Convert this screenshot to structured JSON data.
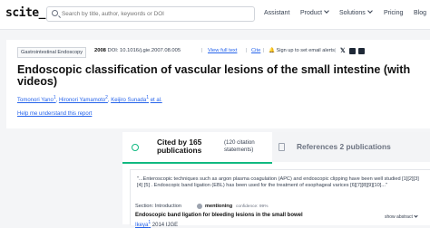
{
  "header": {
    "logo": "scite_",
    "search_placeholder": "Search by title, author, keywords or DOI",
    "nav": {
      "assistant": "Assistant",
      "product": "Product",
      "solutions": "Solutions",
      "pricing": "Pricing",
      "blog": "Blog"
    }
  },
  "paper": {
    "journal": "Gastrointestinal Endoscopy",
    "year": "2008",
    "doi": "DOI: 10.1016/j.gie.2007.08.005",
    "view_full_text": "View full text",
    "cite": "Cite",
    "email_alerts": "Sign up to set email alerts",
    "title": "Endoscopic classification of vascular lesions of the small intestine (with videos)",
    "authors": [
      {
        "name": "Tomonori Yano",
        "sup": "1"
      },
      {
        "name": "Hironori Yamamoto",
        "sup": "2"
      },
      {
        "name": "Keijiro Sunada",
        "sup": "1"
      }
    ],
    "et_al": "et al.",
    "help_link": "Help me understand this report"
  },
  "citations": {
    "cited_by_line1": "Cited by 165",
    "cited_by_line2": "publications",
    "statements_line1": "(120 citation",
    "statements_line2": "statements)",
    "references": "References 2 publications",
    "first_excerpt": "\"...Enteroscopic techniques such as argon plasma coagulation (APC) and endoscopic clipping have been well studied [1][2][3] [4] [5] . Endoscopic band ligation (EBL) has been used for the treatment of esophageal varices [6][7][8][9][10]...\"",
    "section": "Section: Introduction",
    "mention_label": "mentioning",
    "confidence": "confidence: 99%",
    "citing_title": "Endoscopic band ligation for bleeding lesions in the small bowel",
    "citing_author": "Ikeya",
    "citing_sup": "1",
    "citing_year": "2014",
    "citing_code": "IJGE",
    "show_abstract": "show abstract"
  },
  "colors": {
    "accent": "#10b981",
    "link": "#2563eb"
  }
}
